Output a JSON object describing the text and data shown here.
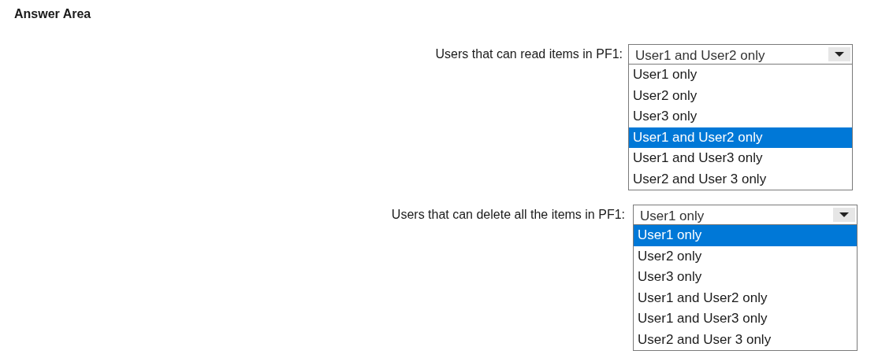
{
  "title": "Answer Area",
  "questions": [
    {
      "label": "Users that can read items in PF1:",
      "value": "User1 and User2 only",
      "options": [
        {
          "label": "User1 only",
          "selected": false
        },
        {
          "label": "User2 only",
          "selected": false
        },
        {
          "label": "User3 only",
          "selected": false
        },
        {
          "label": "User1 and User2 only",
          "selected": true
        },
        {
          "label": "User1 and User3 only",
          "selected": false
        },
        {
          "label": "User2 and User 3 only",
          "selected": false
        }
      ]
    },
    {
      "label": "Users that can delete all the items in PF1:",
      "value": "User1 only",
      "options": [
        {
          "label": "User1 only",
          "selected": true
        },
        {
          "label": "User2 only",
          "selected": false
        },
        {
          "label": "User3 only",
          "selected": false
        },
        {
          "label": "User1 and User2 only",
          "selected": false
        },
        {
          "label": "User1 and User3 only",
          "selected": false
        },
        {
          "label": "User2 and User 3 only",
          "selected": false
        }
      ]
    }
  ]
}
